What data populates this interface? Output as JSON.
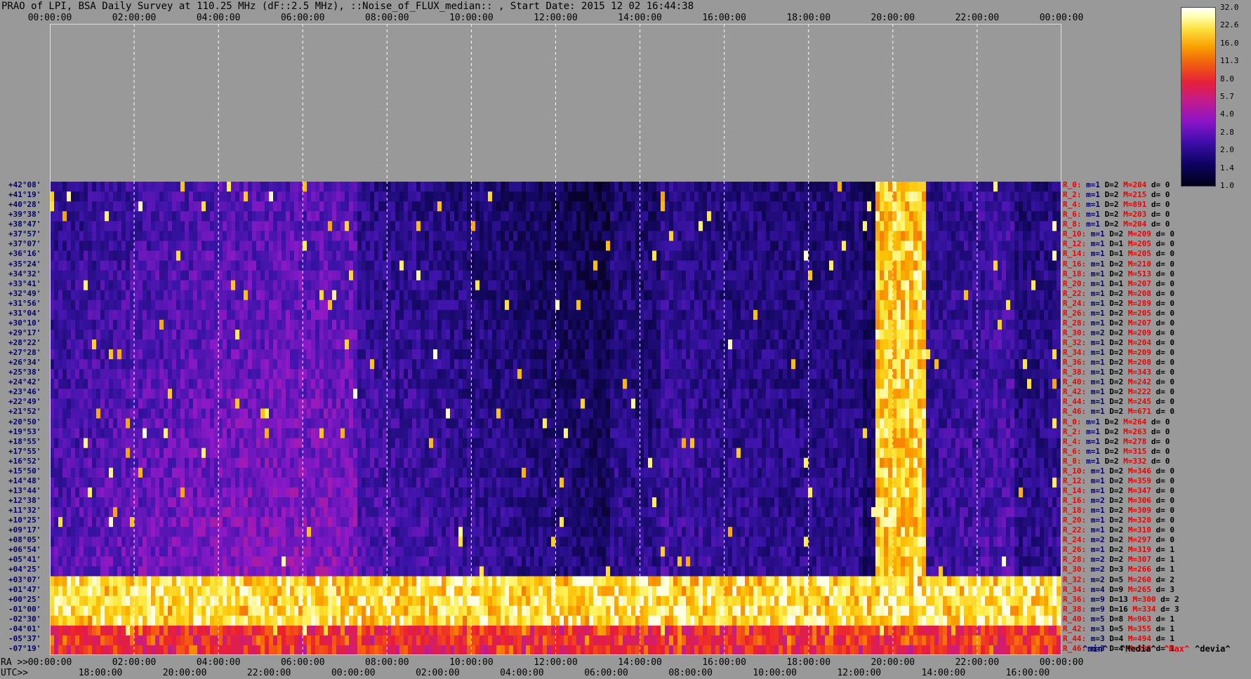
{
  "title": "PRAO of LPI, BSA Daily Survey at 110.25 MHz (dF::2.5 MHz), ::Noise_of_FLUX_median:: , Start Date: 2015 12 02 16:44:38",
  "top_ticks": [
    "00:00:00",
    "02:00:00",
    "04:00:00",
    "06:00:00",
    "08:00:00",
    "10:00:00",
    "12:00:00",
    "14:00:00",
    "16:00:00",
    "18:00:00",
    "20:00:00",
    "22:00:00",
    "00:00:00"
  ],
  "bottom": {
    "ra_label": "RA >>",
    "utc_label": "UTC>>",
    "ra_ticks": [
      "00:00:00",
      "02:00:00",
      "04:00:00",
      "06:00:00",
      "08:00:00",
      "10:00:00",
      "12:00:00",
      "14:00:00",
      "16:00:00",
      "18:00:00",
      "20:00:00",
      "22:00:00",
      "00:00:00"
    ],
    "utc_ticks": [
      "18:00:00",
      "20:00:00",
      "22:00:00",
      "00:00:00",
      "02:00:00",
      "04:00:00",
      "06:00:00",
      "08:00:00",
      "10:00:00",
      "12:00:00",
      "14:00:00",
      "16:00:00"
    ]
  },
  "declinations": [
    "+42°08'",
    "+41°19'",
    "+40°28'",
    "+39°38'",
    "+38°47'",
    "+37°57'",
    "+37°07'",
    "+36°16'",
    "+35°24'",
    "+34°32'",
    "+33°41'",
    "+32°49'",
    "+31°56'",
    "+31°04'",
    "+30°10'",
    "+29°17'",
    "+28°22'",
    "+27°28'",
    "+26°34'",
    "+25°38'",
    "+24°42'",
    "+23°46'",
    "+22°49'",
    "+21°52'",
    "+20°50'",
    "+19°53'",
    "+18°55'",
    "+17°55'",
    "+16°52'",
    "+15°50'",
    "+14°48'",
    "+13°44'",
    "+12°38'",
    "+11°32'",
    "+10°25'",
    "+09°17'",
    "+08°05'",
    "+06°54'",
    "+05°41'",
    "+04°25'",
    "+03°07'",
    "+01°47'",
    "+00°25'",
    "-01°00'",
    "-02°30'",
    "-04°01'",
    "-05°37'",
    "-07°19'"
  ],
  "stats": [
    {
      "r": "R_0:",
      "m": "m=1",
      "d": "D=2",
      "M": "M=204",
      "dv": "d= 0"
    },
    {
      "r": "R_2:",
      "m": "m=1",
      "d": "D=2",
      "M": "M=215",
      "dv": "d= 0"
    },
    {
      "r": "R_4:",
      "m": "m=1",
      "d": "D=2",
      "M": "M=891",
      "dv": "d= 0"
    },
    {
      "r": "R_6:",
      "m": "m=1",
      "d": "D=2",
      "M": "M=203",
      "dv": "d= 0"
    },
    {
      "r": "R_8:",
      "m": "m=1",
      "d": "D=2",
      "M": "M=204",
      "dv": "d= 0"
    },
    {
      "r": "R_10:",
      "m": "m=1",
      "d": "D=2",
      "M": "M=209",
      "dv": "d= 0"
    },
    {
      "r": "R_12:",
      "m": "m=1",
      "d": "D=1",
      "M": "M=205",
      "dv": "d= 0"
    },
    {
      "r": "R_14:",
      "m": "m=1",
      "d": "D=1",
      "M": "M=205",
      "dv": "d= 0"
    },
    {
      "r": "R_16:",
      "m": "m=1",
      "d": "D=2",
      "M": "M=210",
      "dv": "d= 0"
    },
    {
      "r": "R_18:",
      "m": "m=1",
      "d": "D=2",
      "M": "M=513",
      "dv": "d= 0"
    },
    {
      "r": "R_20:",
      "m": "m=1",
      "d": "D=1",
      "M": "M=207",
      "dv": "d= 0"
    },
    {
      "r": "R_22:",
      "m": "m=1",
      "d": "D=2",
      "M": "M=208",
      "dv": "d= 0"
    },
    {
      "r": "R_24:",
      "m": "m=1",
      "d": "D=2",
      "M": "M=289",
      "dv": "d= 0"
    },
    {
      "r": "R_26:",
      "m": "m=1",
      "d": "D=2",
      "M": "M=205",
      "dv": "d= 0"
    },
    {
      "r": "R_28:",
      "m": "m=1",
      "d": "D=2",
      "M": "M=207",
      "dv": "d= 0"
    },
    {
      "r": "R_30:",
      "m": "m=2",
      "d": "D=2",
      "M": "M=209",
      "dv": "d= 0"
    },
    {
      "r": "R_32:",
      "m": "m=1",
      "d": "D=2",
      "M": "M=204",
      "dv": "d= 0"
    },
    {
      "r": "R_34:",
      "m": "m=1",
      "d": "D=2",
      "M": "M=209",
      "dv": "d= 0"
    },
    {
      "r": "R_36:",
      "m": "m=1",
      "d": "D=2",
      "M": "M=208",
      "dv": "d= 0"
    },
    {
      "r": "R_38:",
      "m": "m=1",
      "d": "D=2",
      "M": "M=343",
      "dv": "d= 0"
    },
    {
      "r": "R_40:",
      "m": "m=1",
      "d": "D=2",
      "M": "M=242",
      "dv": "d= 0"
    },
    {
      "r": "R_42:",
      "m": "m=1",
      "d": "D=2",
      "M": "M=222",
      "dv": "d= 0"
    },
    {
      "r": "R_44:",
      "m": "m=1",
      "d": "D=2",
      "M": "M=245",
      "dv": "d= 0"
    },
    {
      "r": "R_46:",
      "m": "m=1",
      "d": "D=2",
      "M": "M=671",
      "dv": "d= 0"
    },
    {
      "r": "R_0:",
      "m": "m=1",
      "d": "D=2",
      "M": "M=264",
      "dv": "d= 0"
    },
    {
      "r": "R_2:",
      "m": "m=1",
      "d": "D=2",
      "M": "M=263",
      "dv": "d= 0"
    },
    {
      "r": "R_4:",
      "m": "m=1",
      "d": "D=2",
      "M": "M=278",
      "dv": "d= 0"
    },
    {
      "r": "R_6:",
      "m": "m=1",
      "d": "D=2",
      "M": "M=315",
      "dv": "d= 0"
    },
    {
      "r": "R_8:",
      "m": "m=1",
      "d": "D=2",
      "M": "M=332",
      "dv": "d= 0"
    },
    {
      "r": "R_10:",
      "m": "m=1",
      "d": "D=2",
      "M": "M=346",
      "dv": "d= 0"
    },
    {
      "r": "R_12:",
      "m": "m=1",
      "d": "D=2",
      "M": "M=359",
      "dv": "d= 0"
    },
    {
      "r": "R_14:",
      "m": "m=1",
      "d": "D=2",
      "M": "M=347",
      "dv": "d= 0"
    },
    {
      "r": "R_16:",
      "m": "m=2",
      "d": "D=2",
      "M": "M=306",
      "dv": "d= 0"
    },
    {
      "r": "R_18:",
      "m": "m=1",
      "d": "D=2",
      "M": "M=309",
      "dv": "d= 0"
    },
    {
      "r": "R_20:",
      "m": "m=1",
      "d": "D=2",
      "M": "M=320",
      "dv": "d= 0"
    },
    {
      "r": "R_22:",
      "m": "m=1",
      "d": "D=2",
      "M": "M=310",
      "dv": "d= 0"
    },
    {
      "r": "R_24:",
      "m": "m=2",
      "d": "D=2",
      "M": "M=297",
      "dv": "d= 0"
    },
    {
      "r": "R_26:",
      "m": "m=1",
      "d": "D=2",
      "M": "M=319",
      "dv": "d= 1"
    },
    {
      "r": "R_28:",
      "m": "m=2",
      "d": "D=2",
      "M": "M=307",
      "dv": "d= 1"
    },
    {
      "r": "R_30:",
      "m": "m=2",
      "d": "D=3",
      "M": "M=266",
      "dv": "d= 1"
    },
    {
      "r": "R_32:",
      "m": "m=2",
      "d": "D=5",
      "M": "M=260",
      "dv": "d= 2"
    },
    {
      "r": "R_34:",
      "m": "m=4",
      "d": "D=9",
      "M": "M=265",
      "dv": "d= 3"
    },
    {
      "r": "R_36:",
      "m": "m=9",
      "d": "D=13",
      "M": "M=300",
      "dv": "d= 2"
    },
    {
      "r": "R_38:",
      "m": "m=9",
      "d": "D=16",
      "M": "M=334",
      "dv": "d= 3"
    },
    {
      "r": "R_40:",
      "m": "m=5",
      "d": "D=8",
      "M": "M=963",
      "dv": "d= 1"
    },
    {
      "r": "R_42:",
      "m": "m=3",
      "d": "D=5",
      "M": "M=355",
      "dv": "d= 1"
    },
    {
      "r": "R_44:",
      "m": "m=3",
      "d": "D=4",
      "M": "M=494",
      "dv": "d= 1"
    },
    {
      "r": "R_46:",
      "m": "m=3",
      "d": "D=4",
      "M": "M=398",
      "dv": "d= 1"
    }
  ],
  "legend": {
    "min": "^min^",
    "median": "^Media^",
    "max": "^Max^",
    "deviation": "^devia^"
  },
  "colorbar": {
    "ticks": [
      "32.0",
      "22.6",
      "16.0",
      "11.3",
      "8.0",
      "5.7",
      "4.0",
      "2.8",
      "2.0",
      "1.4",
      "1.0"
    ]
  },
  "colors": {
    "label_blue": "#00006a",
    "label_red": "#ee0000",
    "background": "#999999"
  }
}
